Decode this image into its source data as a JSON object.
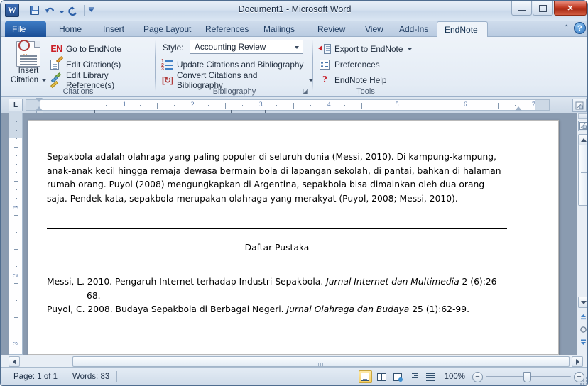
{
  "window": {
    "title": "Document1  -  Microsoft Word",
    "app_icon": "W",
    "quick_access": [
      {
        "name": "save-icon",
        "label": "Save"
      },
      {
        "name": "undo-icon",
        "label": "Undo"
      },
      {
        "name": "redo-icon",
        "label": "Redo"
      },
      {
        "name": "customize-qat-icon",
        "label": "Customize Quick Access Toolbar"
      }
    ],
    "controls": {
      "minimize": "Minimize",
      "maximize": "Restore Down",
      "close": "✕"
    }
  },
  "ribbon": {
    "tabs": [
      {
        "label": "File",
        "kind": "file"
      },
      {
        "label": "Home",
        "kind": "normal"
      },
      {
        "label": "Insert",
        "kind": "normal"
      },
      {
        "label": "Page Layout",
        "kind": "normal"
      },
      {
        "label": "References",
        "kind": "normal"
      },
      {
        "label": "Mailings",
        "kind": "normal"
      },
      {
        "label": "Review",
        "kind": "normal"
      },
      {
        "label": "View",
        "kind": "normal"
      },
      {
        "label": "Add-Ins",
        "kind": "normal"
      },
      {
        "label": "EndNote",
        "kind": "active"
      }
    ],
    "help_label": "?",
    "collapse_label": "⌃",
    "groups": {
      "citations": {
        "label": "Citations",
        "insert_citation": {
          "line1": "Insert",
          "line2": "Citation"
        },
        "items": [
          {
            "label": "Go to EndNote",
            "icon": "endnote-logo-icon"
          },
          {
            "label": "Edit Citation(s)",
            "icon": "edit-citation-icon"
          },
          {
            "label": "Edit Library Reference(s)",
            "icon": "edit-library-reference-icon"
          }
        ]
      },
      "bibliography": {
        "label": "Bibliography",
        "style_label": "Style:",
        "style_value": "Accounting Review",
        "items": [
          {
            "label": "Update Citations and Bibliography",
            "icon": "update-bibliography-icon"
          },
          {
            "label": "Convert Citations and Bibliography",
            "icon": "convert-bibliography-icon",
            "dropdown": true
          }
        ],
        "dialog_launcher": "◪"
      },
      "tools": {
        "label": "Tools",
        "items": [
          {
            "label": "Export to EndNote",
            "icon": "export-to-endnote-icon",
            "dropdown": true
          },
          {
            "label": "Preferences",
            "icon": "preferences-icon"
          },
          {
            "label": "EndNote Help",
            "icon": "help-question-icon"
          }
        ]
      }
    }
  },
  "ruler": {
    "tab_selector": "L",
    "horizontal_numbers": [
      "1",
      "2",
      "3",
      "4",
      "5",
      "6",
      "7"
    ],
    "vertical_numbers": [
      "1",
      "2",
      "3"
    ]
  },
  "document": {
    "paragraph": "Sepakbola adalah olahraga yang paling populer di seluruh dunia (Messi, 2010).  Di kampung-kampung, anak-anak kecil hingga remaja dewasa bermain bola di lapangan sekolah, di pantai, bahkan di halaman rumah orang. Puyol (2008)  mengungkapkan di Argentina, sepakbola bisa dimainkan oleh dua orang saja. Pendek kata, sepakbola merupakan olahraga yang merakyat (Puyol, 2008; Messi, 2010).",
    "bibliography_heading": "Daftar Pustaka",
    "bibliography": [
      {
        "prefix": "Messi, L. 2010.  Pengaruh Internet terhadap Industri Sepakbola. ",
        "journal": "Jurnal Internet dan Multimedia",
        "suffix": " 2 (6):26-68."
      },
      {
        "prefix": "Puyol, C. 2008.  Budaya Sepakbola di Berbagai Negeri. ",
        "journal": "Jurnal Olahraga dan Budaya",
        "suffix": " 25 (1):62-99."
      }
    ]
  },
  "statusbar": {
    "page": "Page: 1 of 1",
    "words": "Words: 83",
    "zoom_level": "100%",
    "zoom_out_label": "−",
    "zoom_in_label": "+",
    "view_buttons": [
      {
        "name": "print-layout-view",
        "active": true
      },
      {
        "name": "full-screen-reading-view",
        "active": false
      },
      {
        "name": "web-layout-view",
        "active": false
      },
      {
        "name": "outline-view",
        "active": false
      },
      {
        "name": "draft-view",
        "active": false
      }
    ]
  },
  "colors": {
    "accent_blue": "#1c4f96",
    "endnote_red": "#cc2027",
    "titlebar_close": "#c03a22",
    "active_view": "#f8d063"
  }
}
